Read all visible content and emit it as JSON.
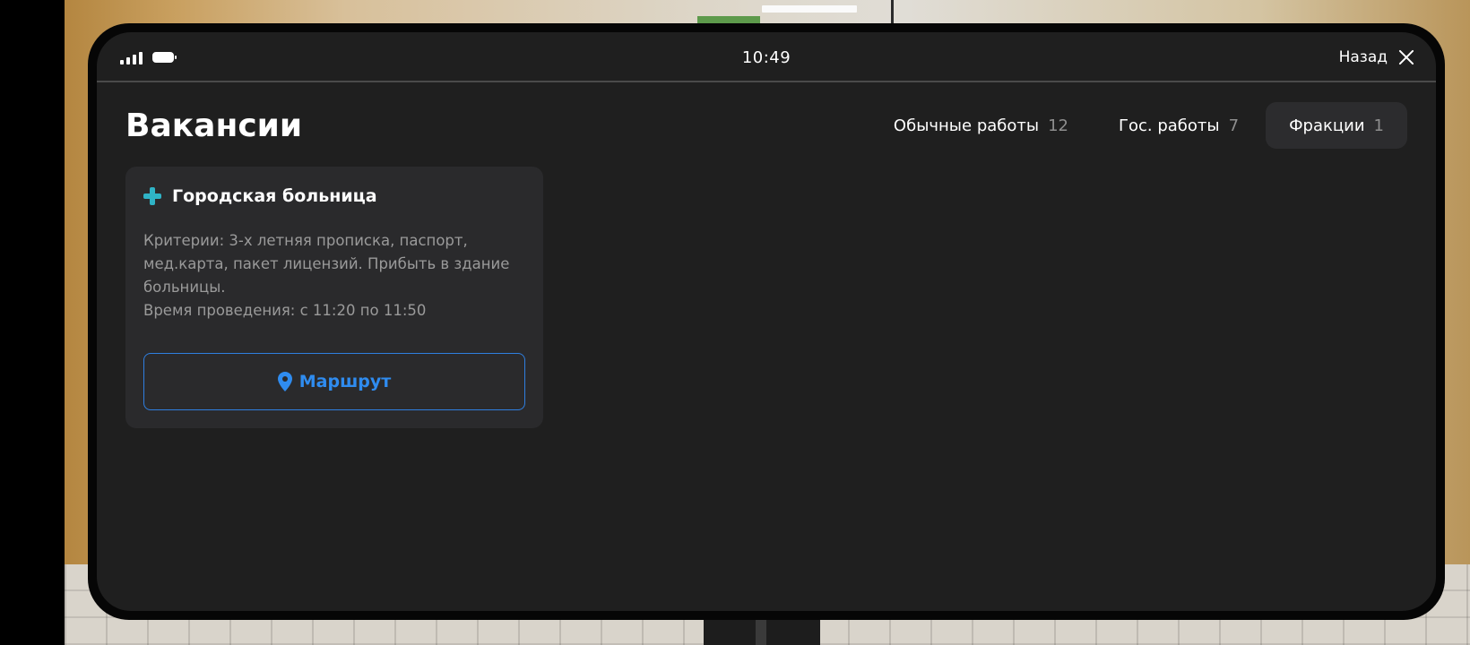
{
  "status_bar": {
    "time": "10:49",
    "back_label": "Назад"
  },
  "page": {
    "title": "Вакансии"
  },
  "tabs": [
    {
      "label": "Обычные работы",
      "count": "12",
      "active": false
    },
    {
      "label": "Гос. работы",
      "count": "7",
      "active": false
    },
    {
      "label": "Фракции",
      "count": "1",
      "active": true
    }
  ],
  "vacancy": {
    "icon": "medical-cross-icon",
    "title": "Городская больница",
    "criteria": "Критерии: 3-х летняя прописка, паспорт, мед.карта, пакет лицензий. Прибыть в здание больницы.",
    "schedule": "Время проведения: с 11:20 по 11:50",
    "route_label": "Маршрут"
  },
  "colors": {
    "background": "#1f1f1f",
    "card": "#2a2a2c",
    "accent_blue": "#2f8cf0",
    "cross_teal": "#2fb3c6"
  }
}
